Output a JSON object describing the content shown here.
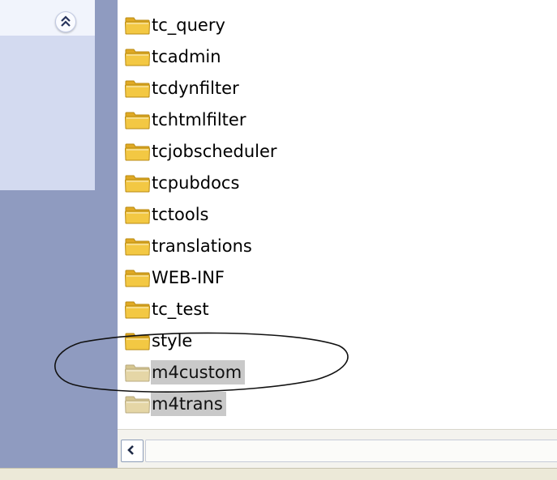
{
  "task_pane": {
    "collapse_icon": "double-chevron-up-icon"
  },
  "folders": [
    {
      "name": "tc_query",
      "state": "normal"
    },
    {
      "name": "tcadmin",
      "state": "normal"
    },
    {
      "name": "tcdynfilter",
      "state": "normal"
    },
    {
      "name": "tchtmlfilter",
      "state": "normal"
    },
    {
      "name": "tcjobscheduler",
      "state": "normal"
    },
    {
      "name": "tcpubdocs",
      "state": "normal"
    },
    {
      "name": "tctools",
      "state": "normal"
    },
    {
      "name": "translations",
      "state": "normal"
    },
    {
      "name": "WEB-INF",
      "state": "normal"
    },
    {
      "name": "tc_test",
      "state": "normal"
    },
    {
      "name": "style",
      "state": "normal"
    },
    {
      "name": "m4custom",
      "state": "cut"
    },
    {
      "name": "m4trans",
      "state": "cut"
    }
  ],
  "scrollbar": {
    "left_arrow_icon": "chevron-left-icon"
  },
  "colors": {
    "task_pane": "#d3daf0",
    "folder": "#f3c843",
    "folder_cut": "#e5d6a6",
    "cut_highlight": "#c9c9c9"
  }
}
